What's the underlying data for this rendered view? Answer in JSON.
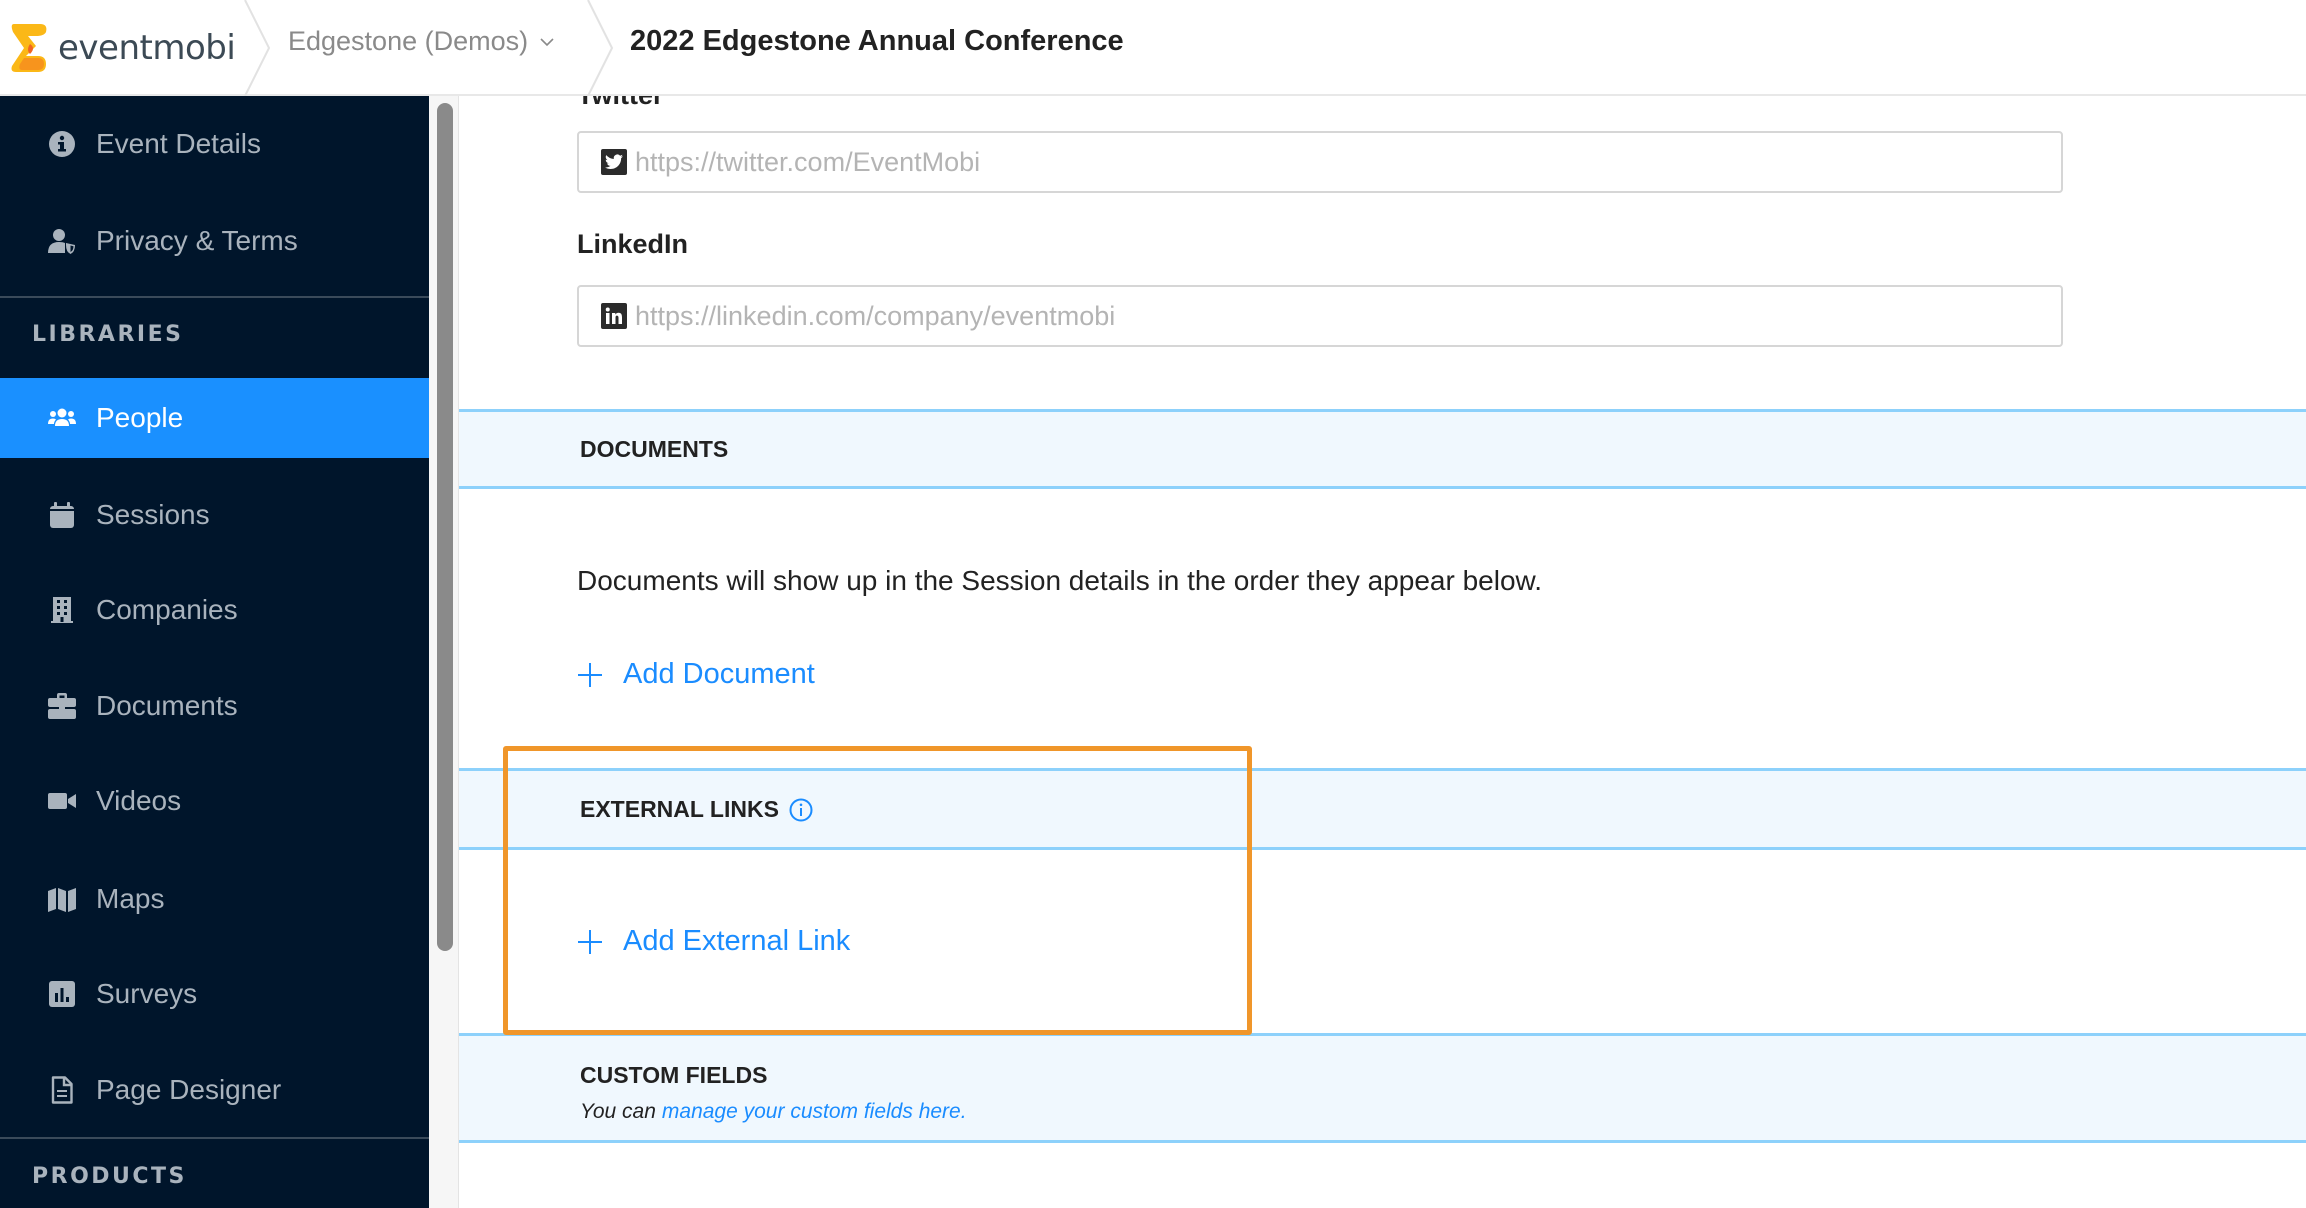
{
  "header": {
    "logo_text": "eventmobi",
    "org_selector": "Edgestone (Demos)",
    "event_title": "2022 Edgestone Annual Conference"
  },
  "sidebar": {
    "items_top": [
      {
        "label": "Event Details",
        "icon": "info-circle-icon"
      },
      {
        "label": "Privacy & Terms",
        "icon": "user-shield-icon"
      }
    ],
    "libraries_heading": "LIBRARIES",
    "libraries": [
      {
        "label": "People",
        "icon": "users-icon",
        "active": true
      },
      {
        "label": "Sessions",
        "icon": "calendar-icon"
      },
      {
        "label": "Companies",
        "icon": "building-icon"
      },
      {
        "label": "Documents",
        "icon": "briefcase-icon"
      },
      {
        "label": "Videos",
        "icon": "video-camera-icon"
      },
      {
        "label": "Maps",
        "icon": "map-icon"
      },
      {
        "label": "Surveys",
        "icon": "bar-chart-icon"
      },
      {
        "label": "Page Designer",
        "icon": "file-text-icon"
      }
    ],
    "products_heading": "PRODUCTS"
  },
  "form": {
    "twitter": {
      "label": "Twitter",
      "value": "",
      "placeholder": "https://twitter.com/EventMobi"
    },
    "linkedin": {
      "label": "LinkedIn",
      "value": "",
      "placeholder": "https://linkedin.com/company/eventmobi"
    }
  },
  "documents": {
    "heading": "DOCUMENTS",
    "description": "Documents will show up in the Session details in the order they appear below.",
    "add_label": "Add Document"
  },
  "external_links": {
    "heading": "EXTERNAL LINKS",
    "add_label": "Add External Link"
  },
  "custom_fields": {
    "heading": "CUSTOM FIELDS",
    "prefix": "You can",
    "link_text": "manage your custom fields here."
  },
  "colors": {
    "accent": "#1a90ff",
    "sidebar_bg": "#00152b",
    "section_bg": "#f0f8fe",
    "section_border": "#8dd1fb",
    "highlight": "#f0962a"
  }
}
